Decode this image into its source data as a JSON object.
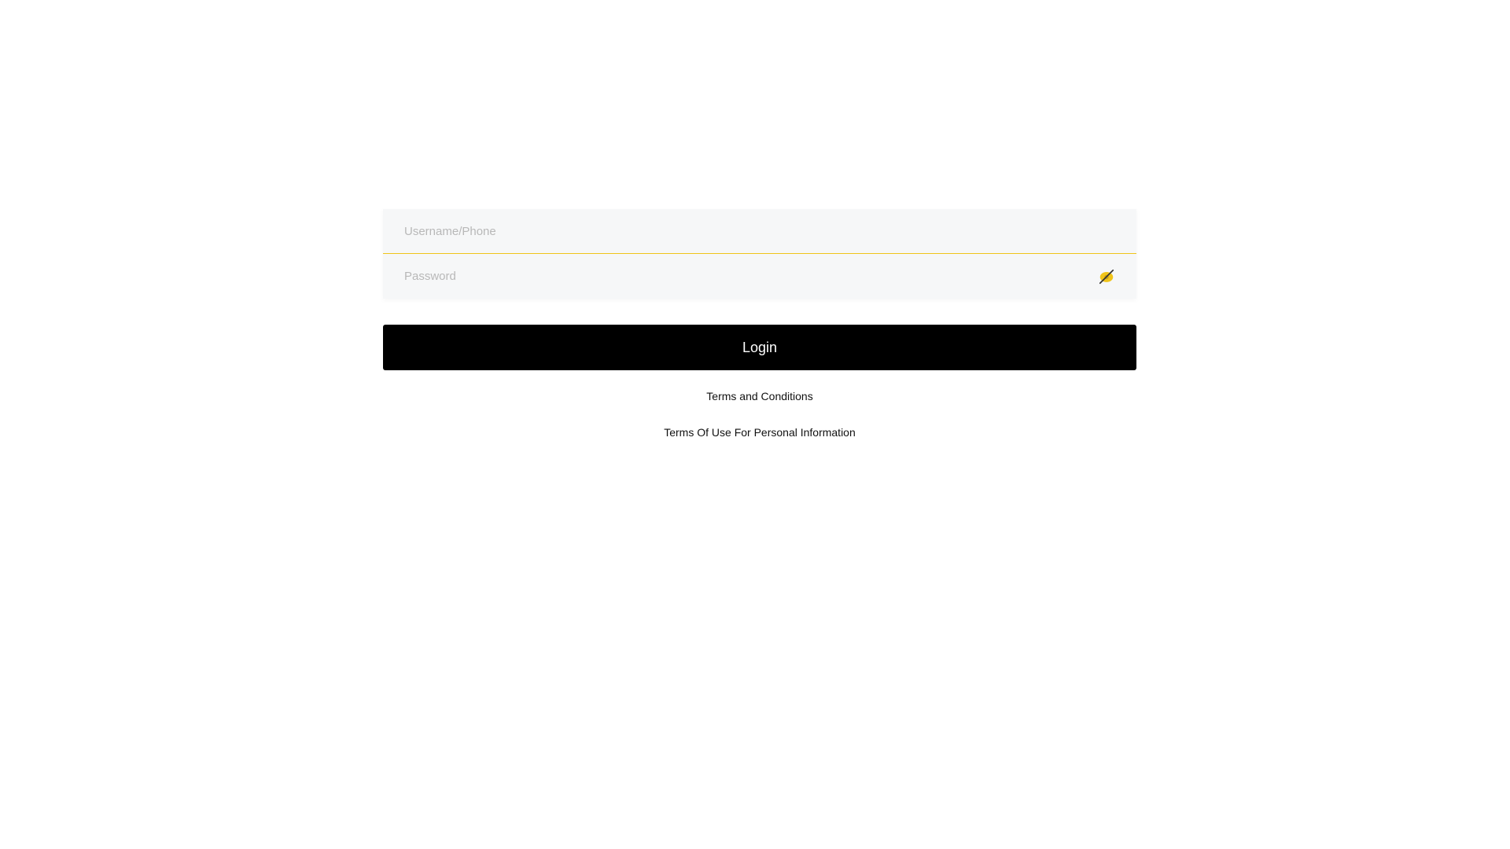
{
  "login_form": {
    "username": {
      "placeholder": "Username/Phone",
      "value": ""
    },
    "password": {
      "placeholder": "Password",
      "value": "",
      "toggle_icon": "eye-off-icon"
    },
    "login_label": "Login"
  },
  "links": {
    "terms": "Terms and Conditions",
    "personal_info": "Terms Of Use For Personal Information"
  },
  "colors": {
    "accent": "#f0c419",
    "button": "#000000",
    "field_bg": "#f6f7f8"
  }
}
